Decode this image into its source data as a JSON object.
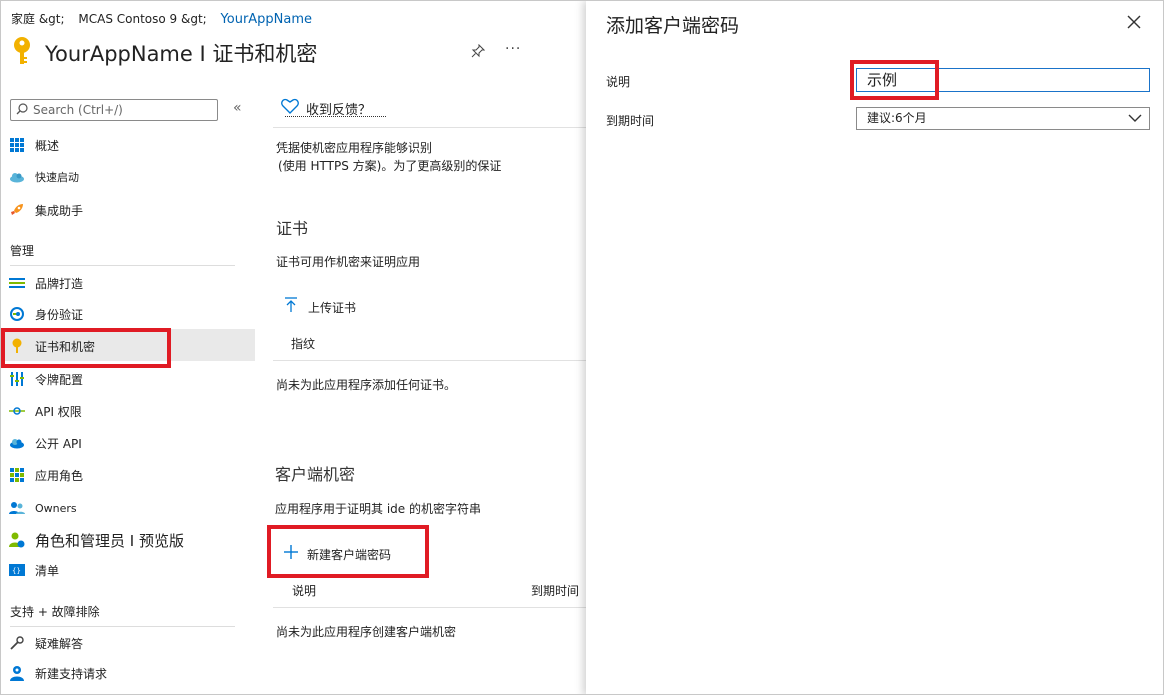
{
  "breadcrumb": {
    "home": "家庭 &gt;",
    "tenant": "MCAS Contoso 9 &gt;",
    "app": "YourAppName"
  },
  "header": {
    "title": "YourAppName I 证书和机密",
    "pin_icon": "pin-icon",
    "more": "···"
  },
  "search": {
    "placeholder": "Search (Ctrl+/)",
    "collapse": "«"
  },
  "sidebar": {
    "top_items": [
      {
        "label": "概述",
        "icon": "overview-grid-icon"
      },
      {
        "label": "快速启动",
        "icon": "quickstart-cloud-icon"
      },
      {
        "label": "集成助手",
        "icon": "rocket-icon"
      }
    ],
    "manage_label": "管理",
    "manage_items": [
      {
        "label": "品牌打造",
        "icon": "branding-icon"
      },
      {
        "label": "身份验证",
        "icon": "authentication-icon"
      },
      {
        "label": "证书和机密",
        "icon": "key-icon"
      },
      {
        "label": "令牌配置",
        "icon": "token-config-icon"
      },
      {
        "label": "API 权限",
        "icon": "api-permissions-icon"
      },
      {
        "label": "公开 API",
        "icon": "expose-api-icon"
      },
      {
        "label": "应用角色",
        "icon": "app-roles-icon"
      },
      {
        "label": "Owners",
        "icon": "owners-icon"
      },
      {
        "label": "角色和管理员 I 预览版",
        "icon": "roles-admins-icon"
      },
      {
        "label": "清单",
        "icon": "manifest-icon"
      }
    ],
    "support_label": "支持 + 故障排除",
    "support_items": [
      {
        "label": "疑难解答",
        "icon": "wrench-icon"
      },
      {
        "label": "新建支持请求",
        "icon": "support-person-icon"
      }
    ]
  },
  "main": {
    "feedback": "收到反馈？",
    "intro_line1": "凭据使机密应用程序能够识别",
    "intro_line2": "(使用 HTTPS 方案)。为了更高级别的保证",
    "certs_heading": "证书",
    "certs_desc": "证书可用作机密来证明应用",
    "upload_cert": "上传证书",
    "thumbprint_col": "指纹",
    "no_certs": "尚未为此应用程序添加任何证书。",
    "secrets_heading": "客户端机密",
    "secrets_desc": "应用程序用于证明其 ide 的机密字符串",
    "new_secret": "新建客户端密码",
    "desc_col": "说明",
    "expires_col": "到期时间",
    "no_secrets": "尚未为此应用程序创建客户端机密"
  },
  "panel": {
    "title": "添加客户端密码",
    "description_label": "说明",
    "description_value": "示例",
    "expires_label": "到期时间",
    "expires_value": "建议:6个月"
  },
  "colors": {
    "accent": "#0063b1",
    "highlight": "#e01b24"
  }
}
